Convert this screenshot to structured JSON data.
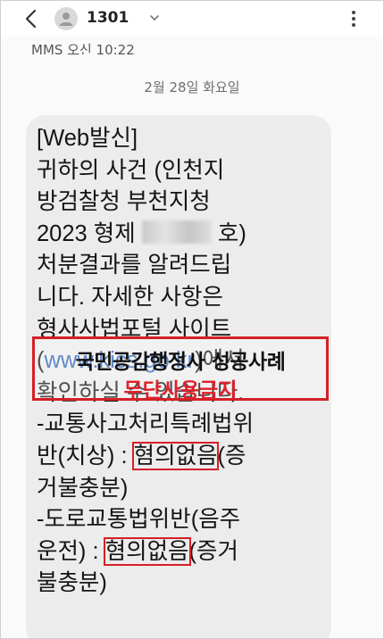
{
  "header": {
    "contact_number": "1301",
    "status_line": "MMS 오신 10:22"
  },
  "date_separator": "2월 28일 화요일",
  "message": {
    "line1": "[Web발신]",
    "line2": "귀하의 사건 (인천지",
    "line3": "방검찰청 부천지청",
    "line4_prefix": "2023 형제 ",
    "line4_suffix": " 호)",
    "line5": "처분결과를 알려드립",
    "line6": "니다. 자세한 사항은",
    "line7": "형사사법포털 사이트",
    "line8_prefix": "(",
    "line8_url": "www.kics.go.kr",
    "line8_suffix": ")에서",
    "line9": "확인하실 수 있습니다.",
    "line10": "-교통사고처리특례법위",
    "line11_prefix": "반(치상) : ",
    "line11_highlight": "혐의없음",
    "line11_suffix": "(증",
    "line12": "거불충분)",
    "line13": "-도로교통법위반(음주",
    "line14_prefix": "운전) : ",
    "line14_highlight": "혐의없음",
    "line14_suffix": "(증거",
    "line15": "불충분)"
  },
  "watermark": {
    "line1": "국민공감행정사 성공사례",
    "line2": "무단사용금지"
  },
  "colors": {
    "highlight": "#d42027",
    "bubble": "#ececec",
    "link": "#2d63b8"
  }
}
